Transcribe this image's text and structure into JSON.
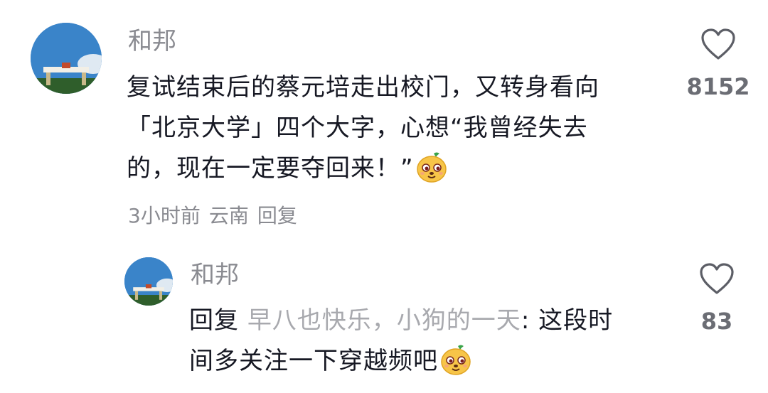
{
  "comment": {
    "username": "和邦",
    "text_lines": [
      "复试结束后的蔡元培走出校门，又转身看向",
      "「北京大学」四个大字，心想“我曾经失去",
      "的，现在一定要夺回来！”"
    ],
    "time": "3小时前",
    "location": "云南",
    "reply_label": "回复",
    "like_count": "8152",
    "emoji_icon": "sly-face-emoji"
  },
  "reply": {
    "username": "和邦",
    "reply_prefix": "回复",
    "reply_target": "早八也快乐，小狗的一天",
    "text_part1": ": 这段时",
    "text_line2": "间多关注一下穿越频吧",
    "like_count": "83",
    "emoji_icon": "sly-face-emoji"
  },
  "icons": {
    "like": "heart-outline-icon",
    "avatar": "campus-gate-photo"
  }
}
